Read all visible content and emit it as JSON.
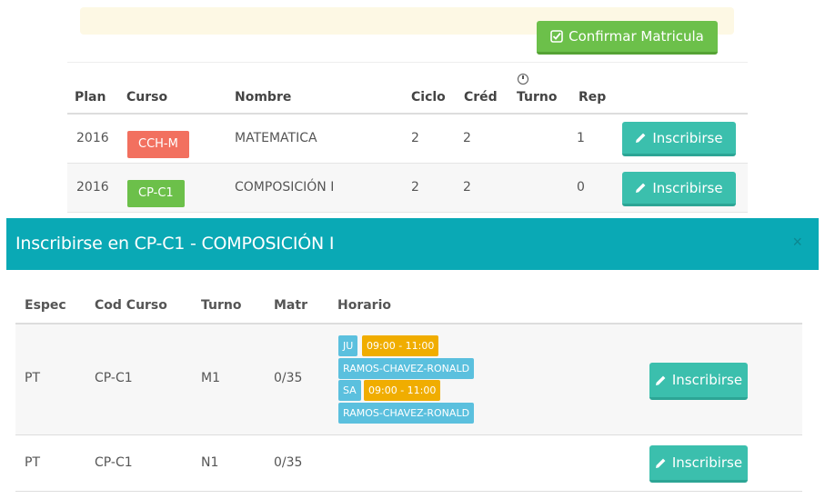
{
  "page": {
    "confirm_label": "Confirmar Matricula",
    "table": {
      "headers": {
        "plan": "Plan",
        "curso": "Curso",
        "nombre": "Nombre",
        "ciclo": "Ciclo",
        "cred": "Créd",
        "turno": "Turno",
        "rep": "Rep"
      },
      "rows": [
        {
          "plan": "2016",
          "curso": "CCH-M",
          "nombre": "MATEMATICA",
          "ciclo": "2",
          "cred": "2",
          "turno": "",
          "rep": "1",
          "action": "Inscribirse"
        },
        {
          "plan": "2016",
          "curso": "CP-C1",
          "nombre": "COMPOSICIÓN I",
          "ciclo": "2",
          "cred": "2",
          "turno": "",
          "rep": "0",
          "action": "Inscribirse"
        }
      ]
    }
  },
  "modal": {
    "title": "Inscribirse en CP-C1 - COMPOSICIÓN I",
    "close": "×",
    "headers": {
      "espec": "Espec",
      "cod_curso": "Cod Curso",
      "turno": "Turno",
      "matr": "Matr",
      "horario": "Horario"
    },
    "rows": [
      {
        "espec": "PT",
        "cod_curso": "CP-C1",
        "turno": "M1",
        "matr": "0/35",
        "schedule": [
          {
            "day": "JU",
            "time": "09:00 - 11:00",
            "teacher": "RAMOS-CHAVEZ-RONALD"
          },
          {
            "day": "SA",
            "time": "09:00 - 11:00",
            "teacher": "RAMOS-CHAVEZ-RONALD"
          }
        ],
        "action": "Inscribirse"
      },
      {
        "espec": "PT",
        "cod_curso": "CP-C1",
        "turno": "N1",
        "matr": "0/35",
        "action": "Inscribirse"
      }
    ]
  },
  "colors": {
    "confirm": "#6cc04a",
    "inscribirse": "#3bbfad",
    "modal_header": "#0aa9b5",
    "label_red": "#f2705f",
    "label_green": "#6cc04a",
    "schedule_blue": "#5bc0de",
    "schedule_yellow": "#f0ad00"
  },
  "icons": {
    "confirm": "check-square-icon",
    "turno": "clock-icon",
    "inscribirse": "pencil-icon",
    "close": "close-icon"
  }
}
